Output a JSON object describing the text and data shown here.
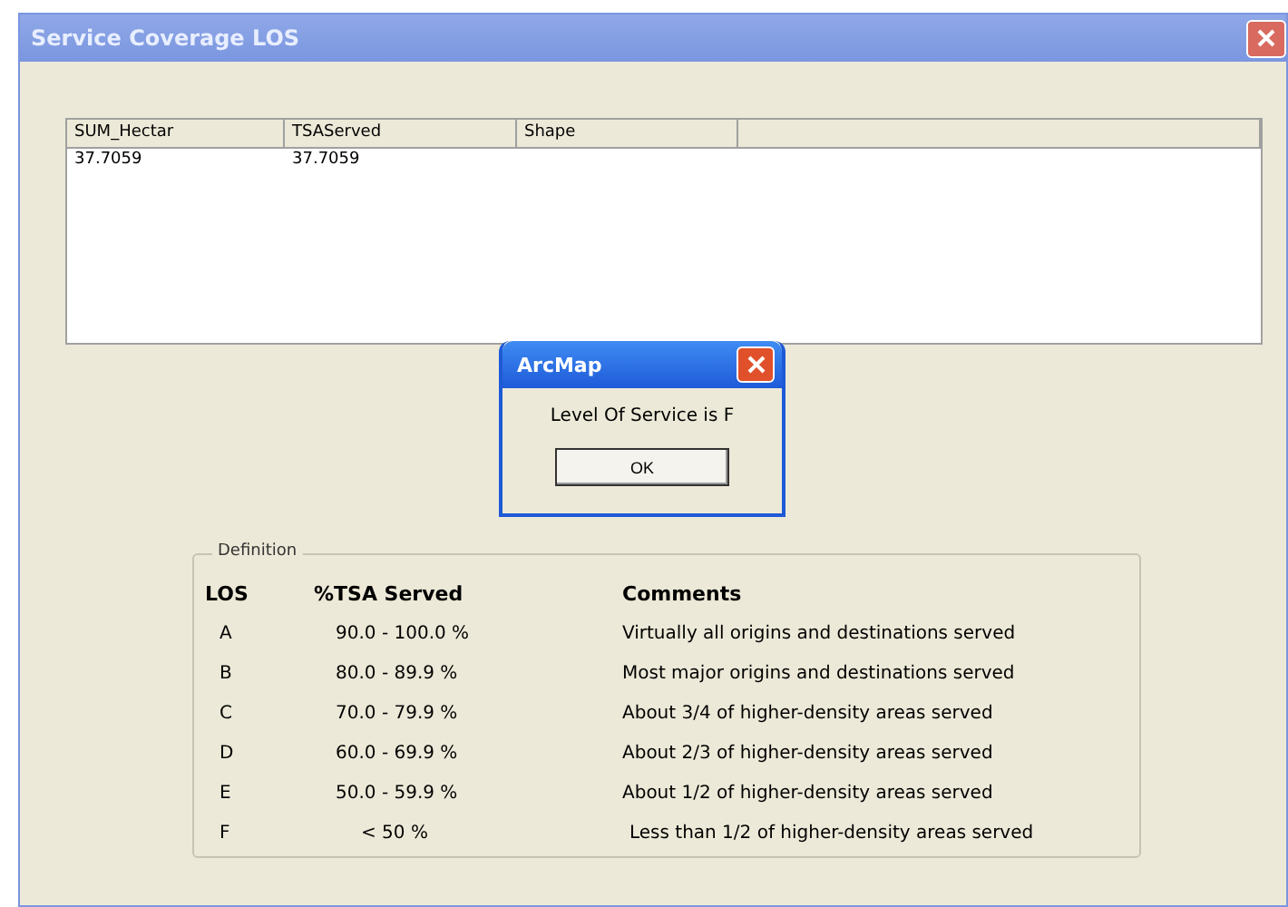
{
  "window": {
    "title": "Service Coverage LOS"
  },
  "table": {
    "columns": [
      "SUM_Hectar",
      "TSAServed",
      "Shape"
    ],
    "rows": [
      [
        "37.7059",
        "37.7059",
        ""
      ]
    ]
  },
  "dialog": {
    "title": "ArcMap",
    "message": "Level Of Service is F",
    "button": "OK"
  },
  "definition": {
    "title": "Definition",
    "headers": [
      "LOS",
      "%TSA Served",
      "Comments"
    ],
    "rows": [
      [
        "A",
        "90.0 - 100.0 %",
        "Virtually all origins and destinations served"
      ],
      [
        "B",
        "80.0 - 89.9 %",
        "Most major origins and destinations served"
      ],
      [
        "C",
        "70.0 - 79.9 %",
        "About 3/4 of higher-density areas served"
      ],
      [
        "D",
        "60.0 - 69.9 %",
        "About 2/3 of higher-density areas served"
      ],
      [
        "E",
        "50.0 - 59.9 %",
        "About 1/2 of higher-density areas served"
      ],
      [
        "F",
        "< 50 %",
        "Less than 1/2 of higher-density areas served"
      ]
    ]
  }
}
